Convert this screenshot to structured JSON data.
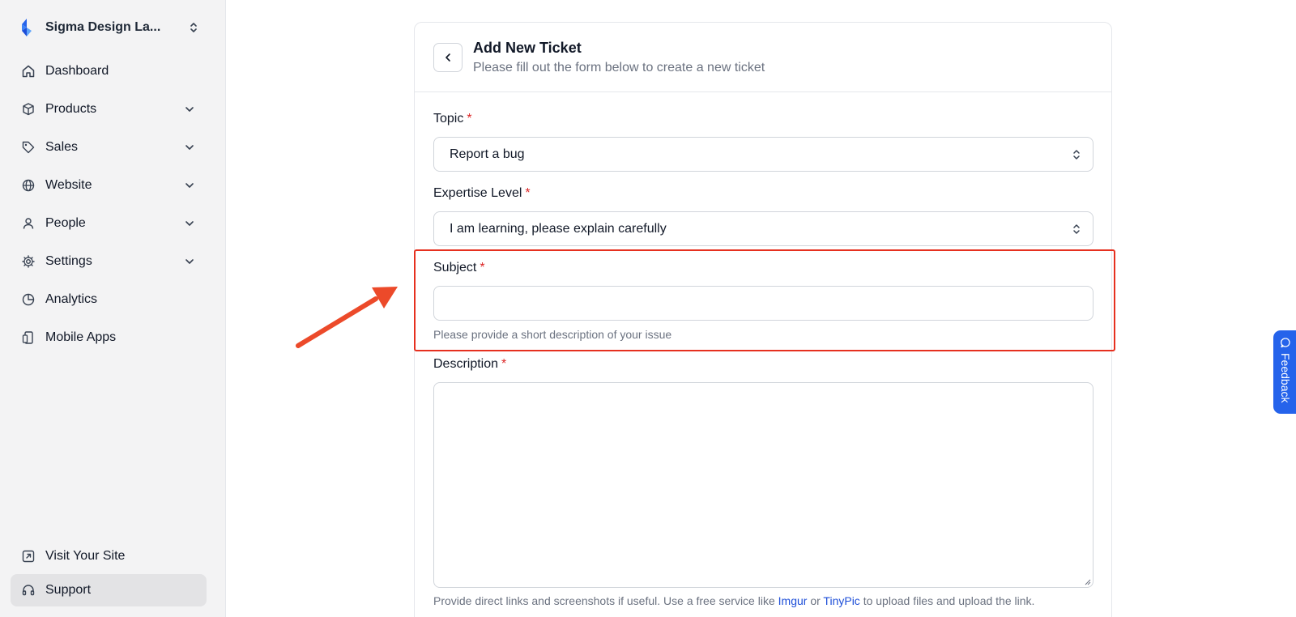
{
  "sidebar": {
    "workspace": "Sigma Design La...",
    "items": [
      {
        "label": "Dashboard"
      },
      {
        "label": "Products"
      },
      {
        "label": "Sales"
      },
      {
        "label": "Website"
      },
      {
        "label": "People"
      },
      {
        "label": "Settings"
      },
      {
        "label": "Analytics"
      },
      {
        "label": "Mobile Apps"
      }
    ],
    "bottom_items": [
      {
        "label": "Visit Your Site"
      },
      {
        "label": "Support"
      }
    ]
  },
  "form": {
    "title": "Add New Ticket",
    "subtitle": "Please fill out the form below to create a new ticket",
    "topic": {
      "label": "Topic",
      "required": "*",
      "value": "Report a bug"
    },
    "expertise": {
      "label": "Expertise Level",
      "required": "*",
      "value": "I am learning, please explain carefully"
    },
    "subject": {
      "label": "Subject",
      "required": "*",
      "value": "",
      "help": "Please provide a short description of your issue"
    },
    "description": {
      "label": "Description",
      "required": "*",
      "value": "",
      "help_prefix": "Provide direct links and screenshots if useful. Use a free service like ",
      "link1": "Imgur",
      "help_or": " or ",
      "link2": "TinyPic",
      "help_suffix": " to upload files and upload the link."
    }
  },
  "feedback_tab": {
    "label": "Feedback"
  },
  "colors": {
    "accent": "#2563eb",
    "highlight": "#e6301f",
    "required": "#dc2626"
  }
}
